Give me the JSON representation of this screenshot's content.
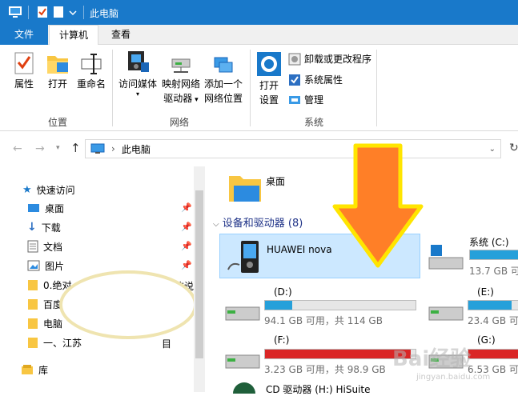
{
  "window": {
    "title": "此电脑"
  },
  "ribbon_tabs": {
    "file": "文件",
    "computer": "计算机",
    "view": "查看"
  },
  "ribbon": {
    "location_group": "位置",
    "network_group": "网络",
    "system_group": "系统",
    "properties": "属性",
    "open": "打开",
    "rename": "重命名",
    "access_media": "访问媒体",
    "map_drive_1": "映射网络",
    "map_drive_2": "驱动器",
    "add_location_1": "添加一个",
    "add_location_2": "网络位置",
    "open_settings_1": "打开",
    "open_settings_2": "设置",
    "uninstall": "卸载或更改程序",
    "sys_props": "系统属性",
    "manage": "管理"
  },
  "address": {
    "path": "此电脑"
  },
  "nav": {
    "quick_access": "快速访问",
    "desktop": "桌面",
    "downloads": "下载",
    "documents": "文档",
    "pictures": "图片",
    "item5": "0.绝对",
    "item5_tail": "信说",
    "item6": "百度",
    "item7": "电脑",
    "item8": "一、江苏",
    "item8_tail": "目",
    "library": "库"
  },
  "content": {
    "desktop_folder": "桌面",
    "devices_header": "设备和驱动器 (8)",
    "huawei": "HUAWEI nova",
    "system_c": "系统 (C:)",
    "c_free": "13.7 GB 可",
    "d_label": "(D:)",
    "d_free": "94.1 GB 可用，共 114 GB",
    "d_fill": 0.18,
    "e_label": "(E:)",
    "e_free": "23.4 GB 可",
    "f_label": "(F:)",
    "f_free": "3.23 GB 可用，共 98.9 GB",
    "f_fill": 0.97,
    "g_label": "(G:)",
    "g_free": "6.53 GB 可",
    "cd_label": "CD 驱动器 (H:) HiSuite"
  },
  "watermark": {
    "main": "Bai经验",
    "sub": "jingyan.baidu.com"
  }
}
